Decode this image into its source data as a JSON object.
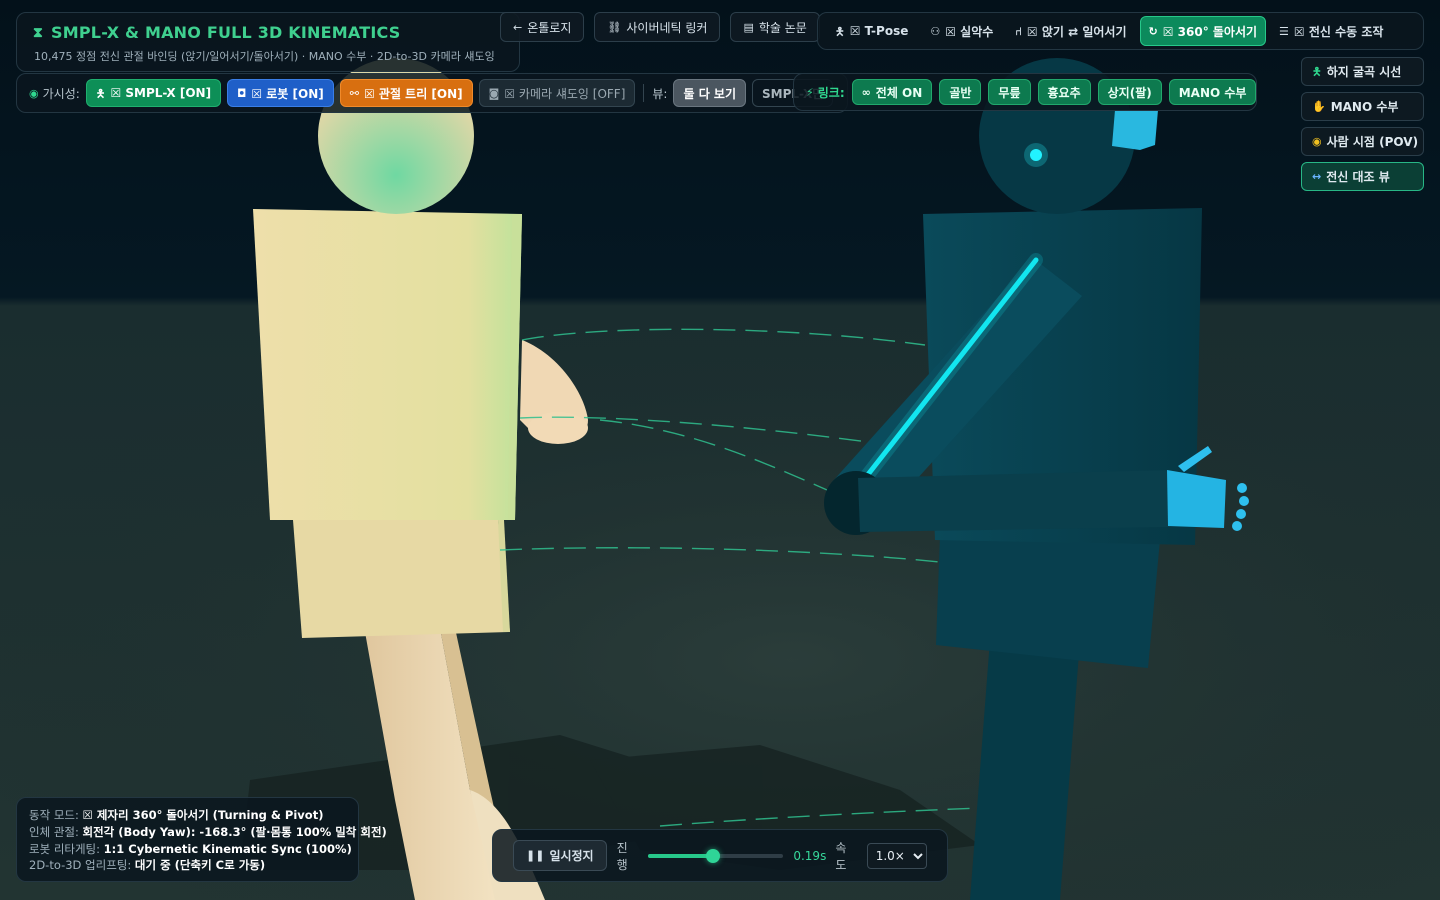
{
  "header": {
    "title": "SMPL-X & MANO FULL 3D KINEMATICS",
    "subtitle": "10,475 정점 전신 관절 바인딩 (앉기/일어서기/돌아서기) · MANO 수부 · 2D-to-3D 카메라 섀도잉",
    "title_icon": "hourglass-icon"
  },
  "top_links": [
    {
      "label": "온톨로지",
      "icon": "arrow-left-icon"
    },
    {
      "label": "사이버네틱 링커",
      "icon": "link-icon"
    },
    {
      "label": "학술 논문",
      "icon": "book-icon"
    }
  ],
  "motions": [
    {
      "label": "☒ T-Pose",
      "icon": "person-icon",
      "active": false
    },
    {
      "label": "☒ 실악수",
      "icon": "handshake-icon",
      "active": false
    },
    {
      "label": "☒ 앉기 ⇄ 일어서기",
      "icon": "chair-icon",
      "active": false
    },
    {
      "label": "☒ 360° 돌아서기",
      "icon": "rotate-icon",
      "active": true
    },
    {
      "label": "☒ 전신 수동 조작",
      "icon": "sliders-icon",
      "active": false
    }
  ],
  "visibility": {
    "label": "가시성:",
    "smplx": "☒ SMPL-X [ON]",
    "robot": "☒ 로봇 [ON]",
    "joint_tree": "☒ 관절 트리 [ON]",
    "camera_shadow": "☒ 카메라 섀도잉 [OFF]",
    "view_label": "뷰:",
    "view_both": "둘 다 보기",
    "view_smplx_only": "SMPL-X만"
  },
  "links": {
    "label": "링크:",
    "all_on": "전체 ON",
    "pelvis": "골반",
    "knee": "무릎",
    "chest": "흉요추",
    "upper_limb": "상지(팔)",
    "mano_hand": "MANO 수부"
  },
  "views": [
    {
      "label": "하지 굴곡 시선",
      "icon": "person-bend-icon",
      "active": false
    },
    {
      "label": "MANO 수부",
      "icon": "hand-icon",
      "active": false
    },
    {
      "label": "사람 시점 (POV)",
      "icon": "eye-icon",
      "active": false
    },
    {
      "label": "전신 대조 뷰",
      "icon": "arrows-horizontal-icon",
      "active": true
    }
  ],
  "status": {
    "mode_label": "동작 모드:",
    "mode_value": "☒ 제자리 360° 돌아서기 (Turning & Pivot)",
    "body_label": "인체 관절:",
    "body_value": "회전각 (Body Yaw): -168.3° (팔·몸통 100% 밀착 회전)",
    "robot_label": "로봇 리타게팅:",
    "robot_value": "1:1 Cybernetic Kinematic Sync (100%)",
    "lift_label": "2D-to-3D 업리프팅:",
    "lift_value": "대기 중 (단축키 C로 가동)"
  },
  "playback": {
    "pause_label": "일시정지",
    "progress_label": "진행",
    "progress_fraction": 0.48,
    "time": "0.19s",
    "speed_label": "속도",
    "speed_value": "1.0×"
  },
  "colors": {
    "accent": "#27c88a",
    "human": "#e9d9a8",
    "robot": "#0b5566",
    "robot_glow": "#12e6f0"
  }
}
